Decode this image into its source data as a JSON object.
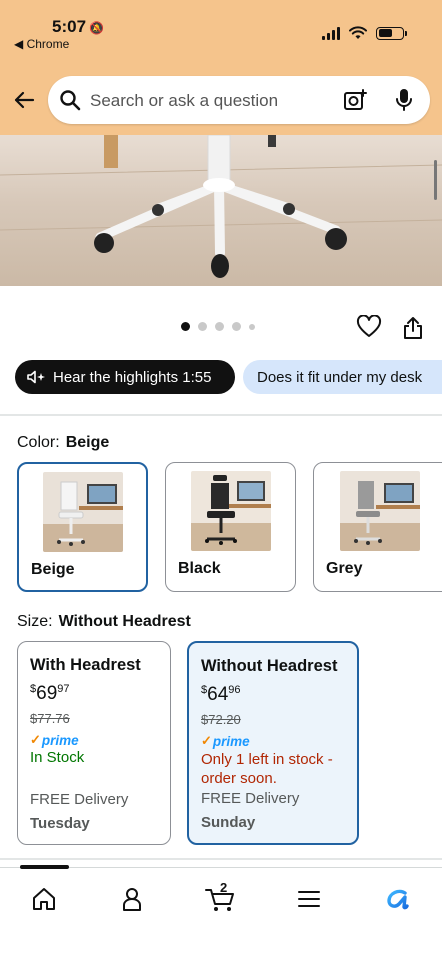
{
  "status_bar": {
    "time": "5:07",
    "back_app": "◀ Chrome"
  },
  "search": {
    "placeholder": "Search or ask a question",
    "icons": [
      "back-arrow-icon",
      "search-icon",
      "camera-icon",
      "microphone-icon"
    ]
  },
  "image_pager": {
    "total_dots": 5,
    "active_index": 0
  },
  "chips": {
    "highlights_label": "Hear the highlights 1:55",
    "question_label": "Does it fit under my desk"
  },
  "color": {
    "label": "Color:",
    "selected": "Beige",
    "options": [
      {
        "label": "Beige",
        "selected": true
      },
      {
        "label": "Black",
        "selected": false
      },
      {
        "label": "Grey",
        "selected": false
      }
    ]
  },
  "size": {
    "label": "Size:",
    "selected": "Without Headrest",
    "options": [
      {
        "title": "With Headrest",
        "price_currency": "$",
        "price_whole": "69",
        "price_fraction": "97",
        "list_price": "$77.76",
        "prime": "prime",
        "stock": "In Stock",
        "delivery": "FREE Delivery",
        "delivery_day": "Tuesday",
        "selected": false
      },
      {
        "title": "Without Headrest",
        "price_currency": "$",
        "price_whole": "64",
        "price_fraction": "96",
        "list_price": "$72.20",
        "prime": "prime",
        "stock": "Only 1 left in stock - order soon.",
        "delivery": "FREE Delivery",
        "delivery_day": "Sunday",
        "selected": true
      }
    ]
  },
  "bottom_nav": {
    "cart_count": "2",
    "items": [
      "home-icon",
      "account-icon",
      "cart-icon",
      "menu-icon",
      "rufus-icon"
    ]
  },
  "colors": {
    "header_bg": "#f5c48c",
    "selected_border": "#2162a1",
    "selected_bg": "#ecf4fb",
    "in_stock": "#007600",
    "low_stock": "#b12704",
    "prime_blue": "#1a98ff",
    "chip_light": "#d6e6fb"
  }
}
